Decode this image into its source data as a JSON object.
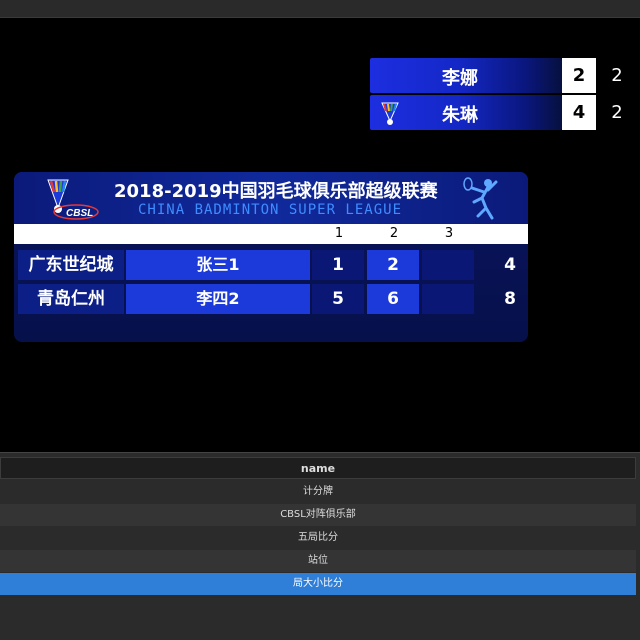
{
  "mini_scorebug": {
    "rows": [
      {
        "name": "李娜",
        "score": "2",
        "games": "2"
      },
      {
        "name": "朱琳",
        "score": "4",
        "games": "2"
      }
    ]
  },
  "board": {
    "title": "2018-2019中国羽毛球俱乐部超级联赛",
    "subtitle": "CHINA BADMINTON SUPER LEAGUE",
    "logo_text": "CBSL",
    "game_headers": [
      "1",
      "2",
      "3"
    ],
    "teams": [
      {
        "team": "广东世纪城",
        "player": "张三1",
        "g1": "1",
        "g2": "2",
        "g3": "",
        "total": "4"
      },
      {
        "team": "青岛仁州",
        "player": "李四2",
        "g1": "5",
        "g2": "6",
        "g3": "",
        "total": "8"
      }
    ]
  },
  "list_panel": {
    "header": "name",
    "items": [
      "计分牌",
      "CBSL对阵俱乐部",
      "五局比分",
      "站位",
      "局大小比分"
    ],
    "selected_index": 4
  },
  "colors": {
    "accent_blue": "#1c39d9",
    "selection": "#2f7fd8",
    "subtitle_blue": "#3f8cff"
  }
}
